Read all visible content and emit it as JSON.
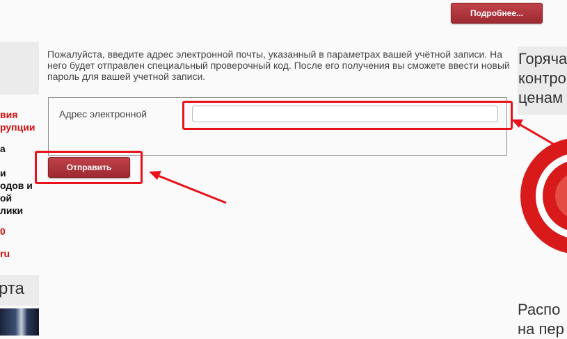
{
  "header": {
    "more_button": "Подробнее..."
  },
  "left_sidebar": {
    "lines": [
      {
        "text": "вия",
        "color": "red"
      },
      {
        "text": "рупции",
        "color": "red"
      },
      {
        "text": "а",
        "color": "black"
      },
      {
        "text": "",
        "color": "black"
      },
      {
        "text": "и",
        "color": "black"
      },
      {
        "text": "одов и",
        "color": "black"
      },
      {
        "text": "ой",
        "color": "black"
      },
      {
        "text": "лики",
        "color": "black"
      },
      {
        "text": "0",
        "color": "red"
      },
      {
        "text": "ru",
        "color": "red"
      }
    ],
    "heading": "рта"
  },
  "main": {
    "intro": "Пожалуйста, введите адрес электронной почты, указанный в параметрах вашей учётной записи. На него будет отправлен специальный проверочный код. После его получения вы сможете ввести новый пароль для вашей учетной записи.",
    "email_label": "Адрес электронной",
    "email_value": "",
    "email_placeholder": "",
    "submit_button": "Отправить"
  },
  "right_column": {
    "heading_lines": [
      "Горяча",
      "контро",
      "ценам"
    ],
    "bottom_lines": [
      "Распо",
      "на пер"
    ]
  },
  "colors": {
    "accent": "#b5353c",
    "annotation": "#e8121b",
    "background": "#fafafa",
    "panel": "#ebebeb"
  }
}
